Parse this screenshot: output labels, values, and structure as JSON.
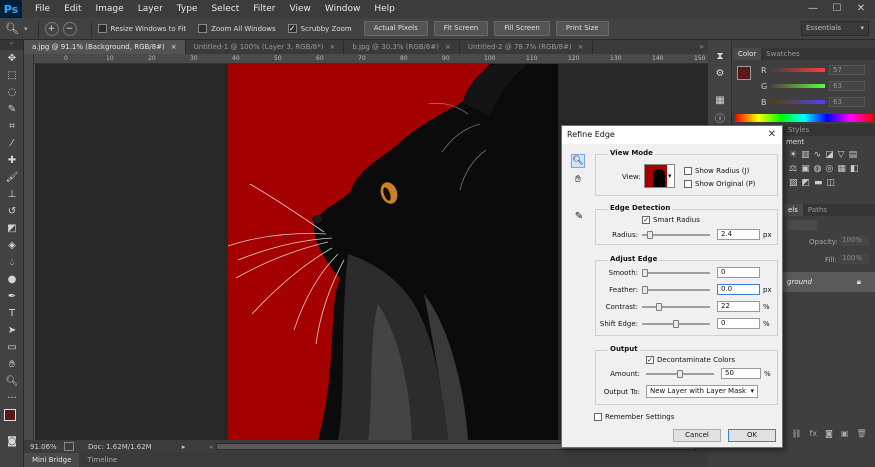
{
  "app": {
    "logo": "Ps"
  },
  "menubar": {
    "items": [
      "File",
      "Edit",
      "Image",
      "Layer",
      "Type",
      "Select",
      "Filter",
      "View",
      "Window",
      "Help"
    ],
    "window_controls": [
      "—",
      "☐",
      "✕"
    ]
  },
  "options": {
    "resize_windows_label": "Resize Windows to Fit",
    "zoom_all_label": "Zoom All Windows",
    "scrubby_zoom_label": "Scrubby Zoom",
    "scrubby_zoom_checked": true,
    "actual_pixels": "Actual Pixels",
    "fit_screen": "Fit Screen",
    "fill_screen": "Fill Screen",
    "print_size": "Print Size",
    "workspace": "Essentials"
  },
  "tabs": [
    {
      "label": "a.jpg @ 91.1% (Background, RGB/8#)",
      "active": true
    },
    {
      "label": "Untitled-1 @ 100% (Layer 3, RGB/8*)",
      "active": false
    },
    {
      "label": "b.jpg @ 30.3% (RGB/8#)",
      "active": false
    },
    {
      "label": "Untitled-2 @ 78.7% (RGB/8#)",
      "active": false
    }
  ],
  "ruler": {
    "h": [
      "0",
      "10",
      "20",
      "30",
      "40",
      "50",
      "60",
      "70",
      "80",
      "90",
      "100",
      "110",
      "120",
      "130",
      "140",
      "150"
    ]
  },
  "status": {
    "zoom": "91.06%",
    "doc": "Doc: 1.62M/1.62M"
  },
  "bottom_tabs": {
    "mini_bridge": "Mini Bridge",
    "timeline": "Timeline"
  },
  "panels": {
    "color_tab": "Color",
    "swatches_tab": "Swatches",
    "r_label": "R",
    "g_label": "G",
    "b_label": "B",
    "r_value": "57",
    "g_value": "63",
    "b_value": "63",
    "styles_tab": "Styles",
    "adjust_label": "ment",
    "paths_tab": "Paths",
    "layers_tab": "els",
    "opacity_label": "Opacity:",
    "opacity_value": "100%",
    "fill_label": "Fill:",
    "fill_value": "100%",
    "layer_name": "ground"
  },
  "dialog": {
    "title": "Refine Edge",
    "view_mode": {
      "title": "View Mode",
      "view_label": "View:",
      "show_radius": "Show Radius (J)",
      "show_original": "Show Original (P)"
    },
    "edge_detection": {
      "title": "Edge Detection",
      "smart_radius": "Smart Radius",
      "radius_label": "Radius:",
      "radius_value": "2.4",
      "radius_unit": "px",
      "radius_level": 0.08
    },
    "adjust_edge": {
      "title": "Adjust Edge",
      "smooth_label": "Smooth:",
      "smooth_value": "0",
      "feather_label": "Feather:",
      "feather_value": "0.0",
      "feather_unit": "px",
      "contrast_label": "Contrast:",
      "contrast_value": "22",
      "contrast_unit": "%",
      "shift_label": "Shift Edge:",
      "shift_value": "0",
      "shift_unit": "%"
    },
    "output": {
      "title": "Output",
      "decontaminate": "Decontaminate Colors",
      "amount_label": "Amount:",
      "amount_value": "50",
      "amount_unit": "%",
      "output_to_label": "Output To:",
      "output_to_value": "New Layer with Layer Mask"
    },
    "remember": "Remember Settings",
    "cancel": "Cancel",
    "ok": "OK"
  },
  "colors": {
    "accent_red": "#a50000",
    "ui_dark": "#535353",
    "dialog_bg": "#f0f0f0"
  }
}
